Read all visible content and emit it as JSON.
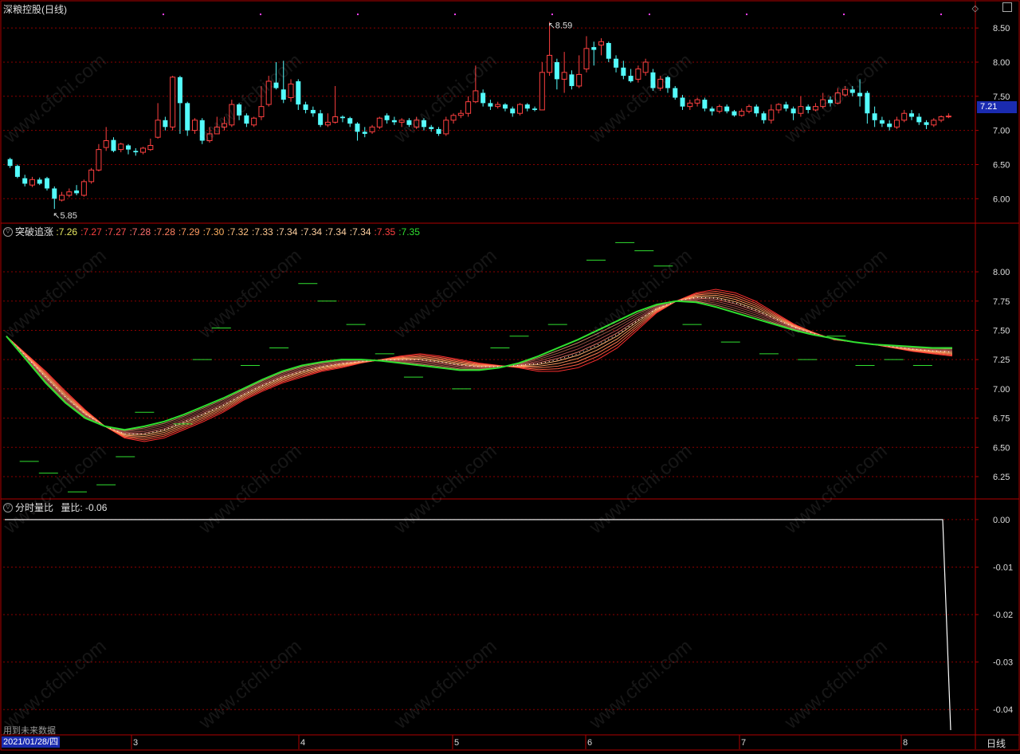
{
  "panel1": {
    "title": "深粮控股(日线)",
    "price_label": "7.21",
    "high_label": "8.59",
    "low_label": "5.85",
    "axis_ticks": [
      "8.50",
      "8.00",
      "7.50",
      "7.00",
      "6.50",
      "6.00"
    ]
  },
  "panel2": {
    "title": "突破追涨",
    "values": [
      {
        "text": ":7.26",
        "color": "#e8e860"
      },
      {
        "text": ":7.27",
        "color": "#ff4040"
      },
      {
        "text": ":7.27",
        "color": "#ff5050"
      },
      {
        "text": ":7.28",
        "color": "#ff7070"
      },
      {
        "text": ":7.28",
        "color": "#ff8060"
      },
      {
        "text": ":7.29",
        "color": "#ff9a60"
      },
      {
        "text": ":7.30",
        "color": "#ffb060"
      },
      {
        "text": ":7.32",
        "color": "#ffc080"
      },
      {
        "text": ":7.33",
        "color": "#ffc890"
      },
      {
        "text": ":7.34",
        "color": "#ffd0a0"
      },
      {
        "text": ":7.34",
        "color": "#ffd0a0"
      },
      {
        "text": ":7.34",
        "color": "#ffd0a0"
      },
      {
        "text": ":7.34",
        "color": "#ffd0a0"
      },
      {
        "text": ":7.35",
        "color": "#ff4040"
      },
      {
        "text": ":7.35",
        "color": "#30e030"
      }
    ],
    "axis_ticks": [
      "8.00",
      "7.75",
      "7.50",
      "7.25",
      "7.00",
      "6.75",
      "6.50",
      "6.25"
    ]
  },
  "panel3": {
    "title": "分时量比",
    "label": "量比: -0.06",
    "axis_ticks": [
      "0.00",
      "-0.01",
      "-0.02",
      "-0.03",
      "-0.04"
    ],
    "note": "用到未来数据"
  },
  "xaxis": {
    "date": "2021/01/28/四",
    "months": [
      "3",
      "4",
      "5",
      "6",
      "7",
      "8"
    ],
    "period": "日线"
  },
  "watermark": "www.cfchi.com",
  "colors": {
    "up": "#ff4040",
    "down": "#54fcfc",
    "grid": "#8b0000",
    "frame": "#b00000",
    "green": "#30e030"
  },
  "chart_data": {
    "type": "candlestick",
    "title": "深粮控股(日线)",
    "ylim": [
      5.7,
      8.7
    ],
    "months": [
      "3",
      "4",
      "5",
      "6",
      "7",
      "8"
    ],
    "ohlc": [
      [
        6.58,
        6.48,
        6.6,
        6.45
      ],
      [
        6.48,
        6.32,
        6.5,
        6.3
      ],
      [
        6.3,
        6.22,
        6.35,
        6.18
      ],
      [
        6.2,
        6.28,
        6.32,
        6.17
      ],
      [
        6.28,
        6.22,
        6.31,
        6.2
      ],
      [
        6.3,
        6.15,
        6.32,
        6.12
      ],
      [
        6.15,
        6.0,
        6.18,
        5.85
      ],
      [
        5.98,
        6.05,
        6.1,
        5.96
      ],
      [
        6.05,
        6.1,
        6.15,
        6.02
      ],
      [
        6.12,
        6.08,
        6.2,
        6.05
      ],
      [
        6.05,
        6.25,
        6.28,
        6.03
      ],
      [
        6.25,
        6.42,
        6.45,
        6.22
      ],
      [
        6.42,
        6.72,
        6.8,
        6.4
      ],
      [
        6.75,
        6.85,
        7.05,
        6.7
      ],
      [
        6.86,
        6.7,
        6.9,
        6.68
      ],
      [
        6.72,
        6.8,
        6.82,
        6.68
      ],
      [
        6.78,
        6.72,
        6.8,
        6.65
      ],
      [
        6.7,
        6.68,
        6.74,
        6.63
      ],
      [
        6.68,
        6.74,
        6.76,
        6.65
      ],
      [
        6.72,
        6.78,
        6.88,
        6.7
      ],
      [
        6.9,
        7.15,
        7.4,
        6.88
      ],
      [
        7.15,
        7.05,
        7.2,
        7.0
      ],
      [
        7.05,
        7.78,
        7.8,
        7.0
      ],
      [
        7.78,
        7.4,
        7.8,
        6.95
      ],
      [
        7.4,
        7.0,
        7.42,
        6.92
      ],
      [
        7.0,
        7.15,
        7.18,
        6.95
      ],
      [
        7.15,
        6.85,
        7.18,
        6.8
      ],
      [
        6.85,
        6.95,
        7.05,
        6.82
      ],
      [
        6.95,
        7.05,
        7.2,
        6.95
      ],
      [
        7.05,
        7.1,
        7.2,
        7.0
      ],
      [
        7.08,
        7.38,
        7.45,
        7.05
      ],
      [
        7.38,
        7.22,
        7.4,
        7.15
      ],
      [
        7.22,
        7.1,
        7.25,
        7.05
      ],
      [
        7.08,
        7.18,
        7.2,
        7.05
      ],
      [
        7.2,
        7.35,
        7.65,
        7.15
      ],
      [
        7.38,
        7.72,
        7.8,
        7.35
      ],
      [
        7.7,
        7.62,
        8.0,
        7.6
      ],
      [
        7.6,
        7.45,
        8.02,
        7.4
      ],
      [
        7.48,
        7.68,
        7.75,
        7.42
      ],
      [
        7.72,
        7.38,
        7.75,
        7.3
      ],
      [
        7.38,
        7.3,
        7.42,
        7.25
      ],
      [
        7.3,
        7.25,
        7.35,
        7.2
      ],
      [
        7.25,
        7.08,
        7.3,
        7.05
      ],
      [
        7.08,
        7.12,
        7.25,
        7.05
      ],
      [
        7.12,
        7.2,
        7.65,
        7.1
      ],
      [
        7.2,
        7.18,
        7.22,
        7.12
      ],
      [
        7.18,
        7.1,
        7.2,
        7.05
      ],
      [
        7.1,
        6.98,
        7.12,
        6.85
      ],
      [
        6.98,
        6.95,
        7.05,
        6.9
      ],
      [
        6.98,
        7.05,
        7.08,
        6.95
      ],
      [
        7.05,
        7.18,
        7.2,
        7.02
      ],
      [
        7.22,
        7.15,
        7.25,
        7.1
      ],
      [
        7.15,
        7.12,
        7.2,
        7.08
      ],
      [
        7.12,
        7.15,
        7.18,
        7.05
      ],
      [
        7.15,
        7.08,
        7.18,
        7.05
      ],
      [
        7.05,
        7.15,
        7.2,
        7.02
      ],
      [
        7.15,
        7.05,
        7.18,
        7.0
      ],
      [
        7.05,
        7.02,
        7.08,
        6.98
      ],
      [
        7.02,
        6.95,
        7.05,
        6.92
      ],
      [
        6.95,
        7.15,
        7.2,
        6.92
      ],
      [
        7.15,
        7.22,
        7.25,
        7.1
      ],
      [
        7.22,
        7.25,
        7.3,
        7.18
      ],
      [
        7.25,
        7.42,
        7.5,
        7.2
      ],
      [
        7.42,
        7.58,
        7.95,
        7.4
      ],
      [
        7.55,
        7.4,
        7.6,
        7.35
      ],
      [
        7.4,
        7.35,
        7.45,
        7.3
      ],
      [
        7.35,
        7.38,
        7.42,
        7.32
      ],
      [
        7.38,
        7.32,
        7.4,
        7.28
      ],
      [
        7.32,
        7.25,
        7.35,
        7.2
      ],
      [
        7.25,
        7.38,
        7.4,
        7.22
      ],
      [
        7.38,
        7.32,
        7.4,
        7.28
      ],
      [
        7.32,
        7.3,
        7.35,
        7.28
      ],
      [
        7.3,
        7.85,
        8.0,
        7.3
      ],
      [
        7.85,
        8.1,
        8.59,
        7.8
      ],
      [
        8.0,
        7.75,
        8.05,
        7.6
      ],
      [
        7.75,
        7.85,
        8.15,
        7.55
      ],
      [
        7.82,
        7.65,
        7.88,
        7.6
      ],
      [
        7.65,
        7.82,
        8.1,
        7.62
      ],
      [
        7.9,
        8.2,
        8.38,
        7.85
      ],
      [
        8.22,
        8.18,
        8.3,
        7.95
      ],
      [
        8.25,
        8.3,
        8.35,
        8.1
      ],
      [
        8.28,
        8.05,
        8.3,
        8.0
      ],
      [
        8.05,
        7.92,
        8.1,
        7.85
      ],
      [
        7.92,
        7.8,
        8.02,
        7.75
      ],
      [
        7.8,
        7.72,
        7.9,
        7.7
      ],
      [
        7.75,
        7.9,
        7.95,
        7.7
      ],
      [
        7.85,
        8.0,
        8.05,
        7.8
      ],
      [
        7.85,
        7.62,
        7.9,
        7.58
      ],
      [
        7.62,
        7.75,
        7.8,
        7.58
      ],
      [
        7.78,
        7.62,
        7.8,
        7.55
      ],
      [
        7.62,
        7.48,
        7.65,
        7.45
      ],
      [
        7.48,
        7.35,
        7.52,
        7.3
      ],
      [
        7.35,
        7.4,
        7.45,
        7.3
      ],
      [
        7.4,
        7.45,
        7.48,
        7.35
      ],
      [
        7.45,
        7.32,
        7.48,
        7.28
      ],
      [
        7.32,
        7.28,
        7.35,
        7.22
      ],
      [
        7.28,
        7.35,
        7.38,
        7.25
      ],
      [
        7.35,
        7.28,
        7.38,
        7.25
      ],
      [
        7.28,
        7.22,
        7.3,
        7.2
      ],
      [
        7.22,
        7.28,
        7.32,
        7.2
      ],
      [
        7.28,
        7.35,
        7.38,
        7.25
      ],
      [
        7.35,
        7.25,
        7.38,
        7.2
      ],
      [
        7.25,
        7.15,
        7.28,
        7.1
      ],
      [
        7.15,
        7.3,
        7.38,
        7.1
      ],
      [
        7.3,
        7.38,
        7.4,
        7.25
      ],
      [
        7.38,
        7.32,
        7.42,
        7.28
      ],
      [
        7.32,
        7.25,
        7.35,
        7.15
      ],
      [
        7.25,
        7.35,
        7.5,
        7.2
      ],
      [
        7.35,
        7.3,
        7.38,
        7.25
      ],
      [
        7.3,
        7.35,
        7.4,
        7.28
      ],
      [
        7.35,
        7.45,
        7.55,
        7.32
      ],
      [
        7.45,
        7.4,
        7.5,
        7.35
      ],
      [
        7.4,
        7.55,
        7.62,
        7.38
      ],
      [
        7.52,
        7.6,
        7.65,
        7.5
      ],
      [
        7.6,
        7.55,
        7.65,
        7.5
      ],
      [
        7.55,
        7.5,
        7.75,
        7.35
      ],
      [
        7.55,
        7.25,
        7.58,
        7.1
      ],
      [
        7.25,
        7.15,
        7.35,
        7.05
      ],
      [
        7.15,
        7.1,
        7.2,
        7.05
      ],
      [
        7.1,
        7.05,
        7.15,
        7.0
      ],
      [
        7.05,
        7.15,
        7.2,
        7.02
      ],
      [
        7.15,
        7.25,
        7.3,
        7.12
      ],
      [
        7.25,
        7.2,
        7.3,
        7.15
      ],
      [
        7.2,
        7.12,
        7.25,
        7.08
      ],
      [
        7.12,
        7.08,
        7.15,
        7.02
      ],
      [
        7.08,
        7.15,
        7.18,
        7.05
      ],
      [
        7.15,
        7.2,
        7.22,
        7.12
      ],
      [
        7.2,
        7.21,
        7.25,
        7.18
      ]
    ],
    "breakout_ribbon": {
      "ylim": [
        6.1,
        8.3
      ],
      "ma_fast": [
        7.45,
        7.3,
        7.15,
        6.98,
        6.82,
        6.68,
        6.58,
        6.55,
        6.58,
        6.65,
        6.72,
        6.8,
        6.9,
        6.98,
        7.05,
        7.1,
        7.15,
        7.18,
        7.22,
        7.25,
        7.28,
        7.3,
        7.28,
        7.25,
        7.22,
        7.2,
        7.18,
        7.15,
        7.15,
        7.18,
        7.25,
        7.35,
        7.5,
        7.65,
        7.75,
        7.82,
        7.85,
        7.82,
        7.75,
        7.65,
        7.55,
        7.48,
        7.42,
        7.4,
        7.38,
        7.35,
        7.32,
        7.3,
        7.28
      ],
      "ma_slow": [
        7.45,
        7.25,
        7.05,
        6.88,
        6.75,
        6.68,
        6.65,
        6.68,
        6.72,
        6.78,
        6.85,
        6.92,
        7.0,
        7.08,
        7.15,
        7.2,
        7.23,
        7.25,
        7.25,
        7.24,
        7.22,
        7.2,
        7.18,
        7.16,
        7.16,
        7.18,
        7.22,
        7.28,
        7.35,
        7.42,
        7.5,
        7.58,
        7.66,
        7.72,
        7.75,
        7.74,
        7.7,
        7.65,
        7.6,
        7.55,
        7.5,
        7.46,
        7.43,
        7.4,
        7.38,
        7.37,
        7.36,
        7.35,
        7.35
      ],
      "scatter_points": [
        [
          1,
          6.38
        ],
        [
          3,
          6.28
        ],
        [
          6,
          6.12
        ],
        [
          9,
          6.18
        ],
        [
          11,
          6.42
        ],
        [
          13,
          6.8
        ],
        [
          17,
          6.7
        ],
        [
          19,
          7.25
        ],
        [
          21,
          7.52
        ],
        [
          24,
          7.2
        ],
        [
          27,
          7.35
        ],
        [
          30,
          7.9
        ],
        [
          32,
          7.75
        ],
        [
          35,
          7.55
        ],
        [
          38,
          7.3
        ],
        [
          41,
          7.1
        ],
        [
          46,
          7.0
        ],
        [
          50,
          7.35
        ],
        [
          52,
          7.45
        ],
        [
          56,
          7.55
        ],
        [
          60,
          8.1
        ],
        [
          63,
          8.25
        ],
        [
          65,
          8.18
        ],
        [
          67,
          8.05
        ],
        [
          70,
          7.55
        ],
        [
          74,
          7.4
        ],
        [
          78,
          7.3
        ],
        [
          82,
          7.25
        ],
        [
          85,
          7.45
        ],
        [
          88,
          7.2
        ],
        [
          91,
          7.25
        ],
        [
          94,
          7.2
        ]
      ]
    },
    "volume_ratio": {
      "ylim": [
        -0.045,
        0.002
      ],
      "value": -0.06
    }
  }
}
